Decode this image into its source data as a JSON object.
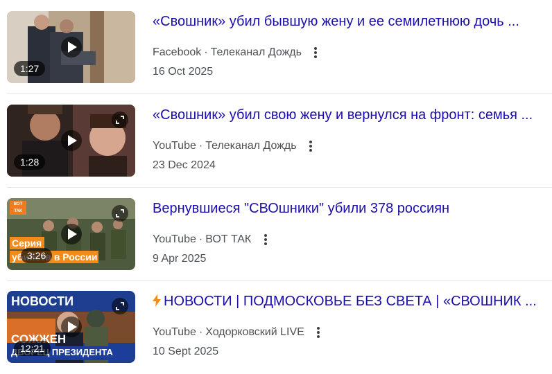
{
  "results": [
    {
      "title": "«Свошник» убил бывшую жену и ее семилетнюю дочь ...",
      "source": "Facebook",
      "channel": "Телеканал Дождь",
      "date": "16 Oct 2025",
      "duration": "1:27",
      "has_expand": false
    },
    {
      "title": "«Свошник» убил свою жену и вернулся на фронт: семья ...",
      "source": "YouTube",
      "channel": "Телеканал Дождь",
      "date": "23 Dec 2024",
      "duration": "1:28",
      "has_expand": true
    },
    {
      "title": "Вернувшиеся \"СВОшники\" убили 378 россиян",
      "source": "YouTube",
      "channel": "ВОТ ТАК",
      "date": "9 Apr 2025",
      "duration": "3:26",
      "has_expand": true,
      "thumb_text": {
        "badge": "ВОТ ТАК",
        "caption1": "Серия",
        "caption2": "убийств в России"
      }
    },
    {
      "title": "НОВОСТИ | ПОДМОСКОВЬЕ БЕЗ СВЕТА | «СВОШНИК ...",
      "title_icon": "lightning-icon",
      "source": "YouTube",
      "channel": "Ходорковский LIVE",
      "date": "10 Sept 2025",
      "duration": "12:21",
      "has_expand": true,
      "thumb_text": {
        "headline": "НОВОСТИ",
        "caption1": "СОЖЖЕН",
        "caption2": "ДВОРЕЦ ПРЕЗИДЕНТА"
      }
    }
  ],
  "separator": "·",
  "colors": {
    "title_link": "#1a0dab",
    "meta_text": "#4d5156",
    "bolt": "#f28b1a",
    "divider": "#e3e3e3"
  }
}
